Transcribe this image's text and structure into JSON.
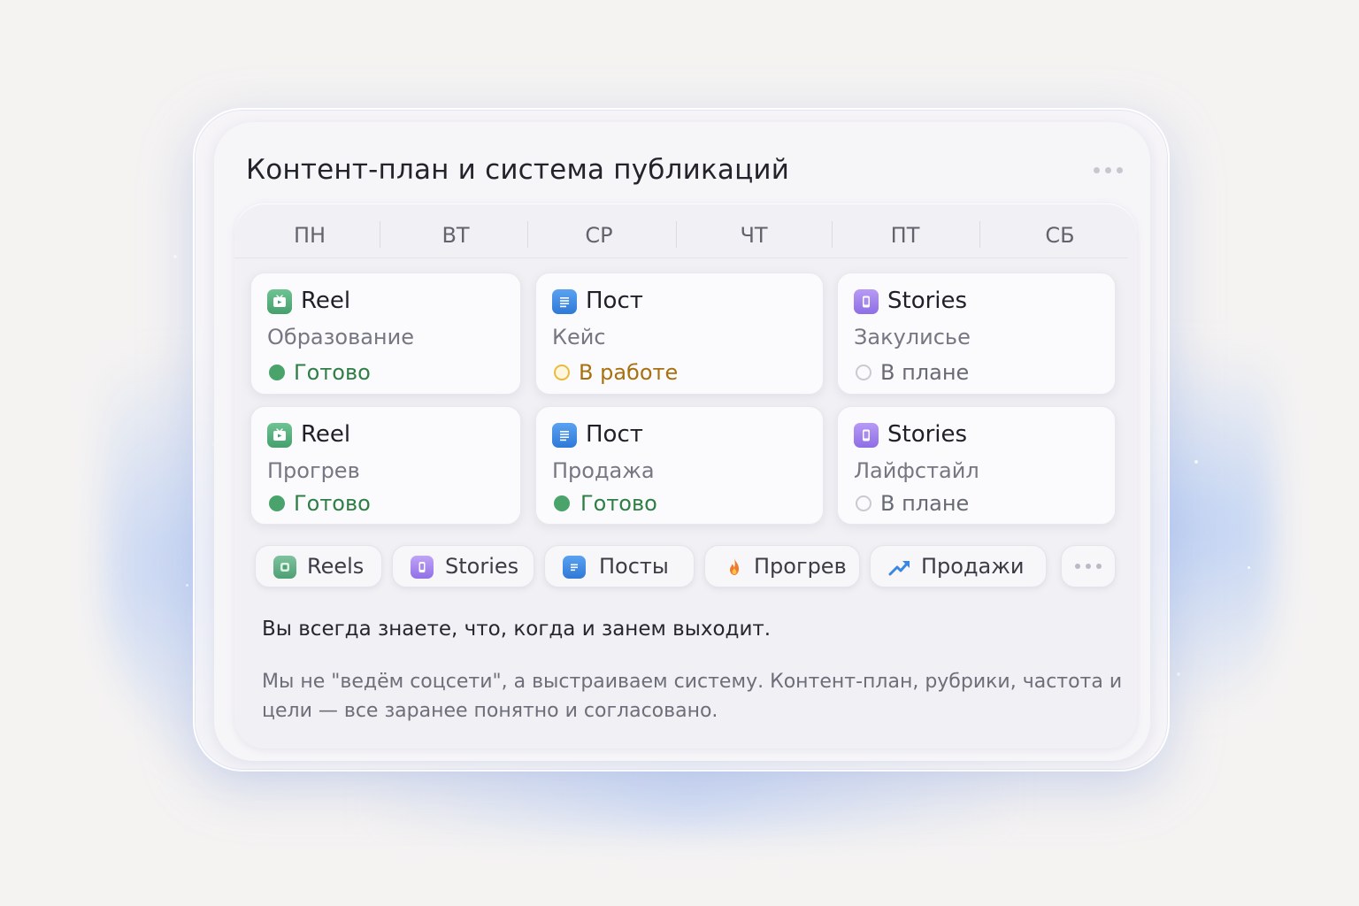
{
  "title": "Контент-план и система публикаций",
  "days": [
    "ПН",
    "ВТ",
    "СР",
    "ЧТ",
    "ПТ",
    "СБ"
  ],
  "cards": [
    {
      "type": "Reel",
      "topic": "Образование",
      "status": "Готово",
      "icon": "reel-icon"
    },
    {
      "type": "Пост",
      "topic": "Кейс",
      "status": "В работе",
      "icon": "post-icon"
    },
    {
      "type": "Stories",
      "topic": "Закулисье",
      "status": "В плане",
      "icon": "stories-icon"
    },
    {
      "type": "Reel",
      "topic": "Прогрев",
      "status": "Готово",
      "icon": "reel-icon"
    },
    {
      "type": "Пост",
      "topic": "Продажа",
      "status": "Готово",
      "icon": "post-icon"
    },
    {
      "type": "Stories",
      "topic": "Лайфстайл",
      "status": "В плане",
      "icon": "stories-icon"
    }
  ],
  "filters": [
    {
      "label": "Reels",
      "icon": "reels-icon"
    },
    {
      "label": "Stories",
      "icon": "stories-icon"
    },
    {
      "label": "Посты",
      "icon": "posts-icon"
    },
    {
      "label": "Прогрев",
      "icon": "fire-icon"
    },
    {
      "label": "Продажи",
      "icon": "trend-up-icon"
    }
  ],
  "headline": "Вы всегда знаете, что, когда и занем выходит.",
  "description": "Мы не \"ведём соцсети\", а выстраиваем систему. Контент-план, рубрики, частота и цели — все заранее понятно и согласовано.",
  "colors": {
    "ready": "#49a36a",
    "in_progress": "#e8bb3f",
    "planned": "#c9cad2",
    "reel": "#45a06c",
    "post": "#2f79d8",
    "stories": "#8e6ee6"
  }
}
